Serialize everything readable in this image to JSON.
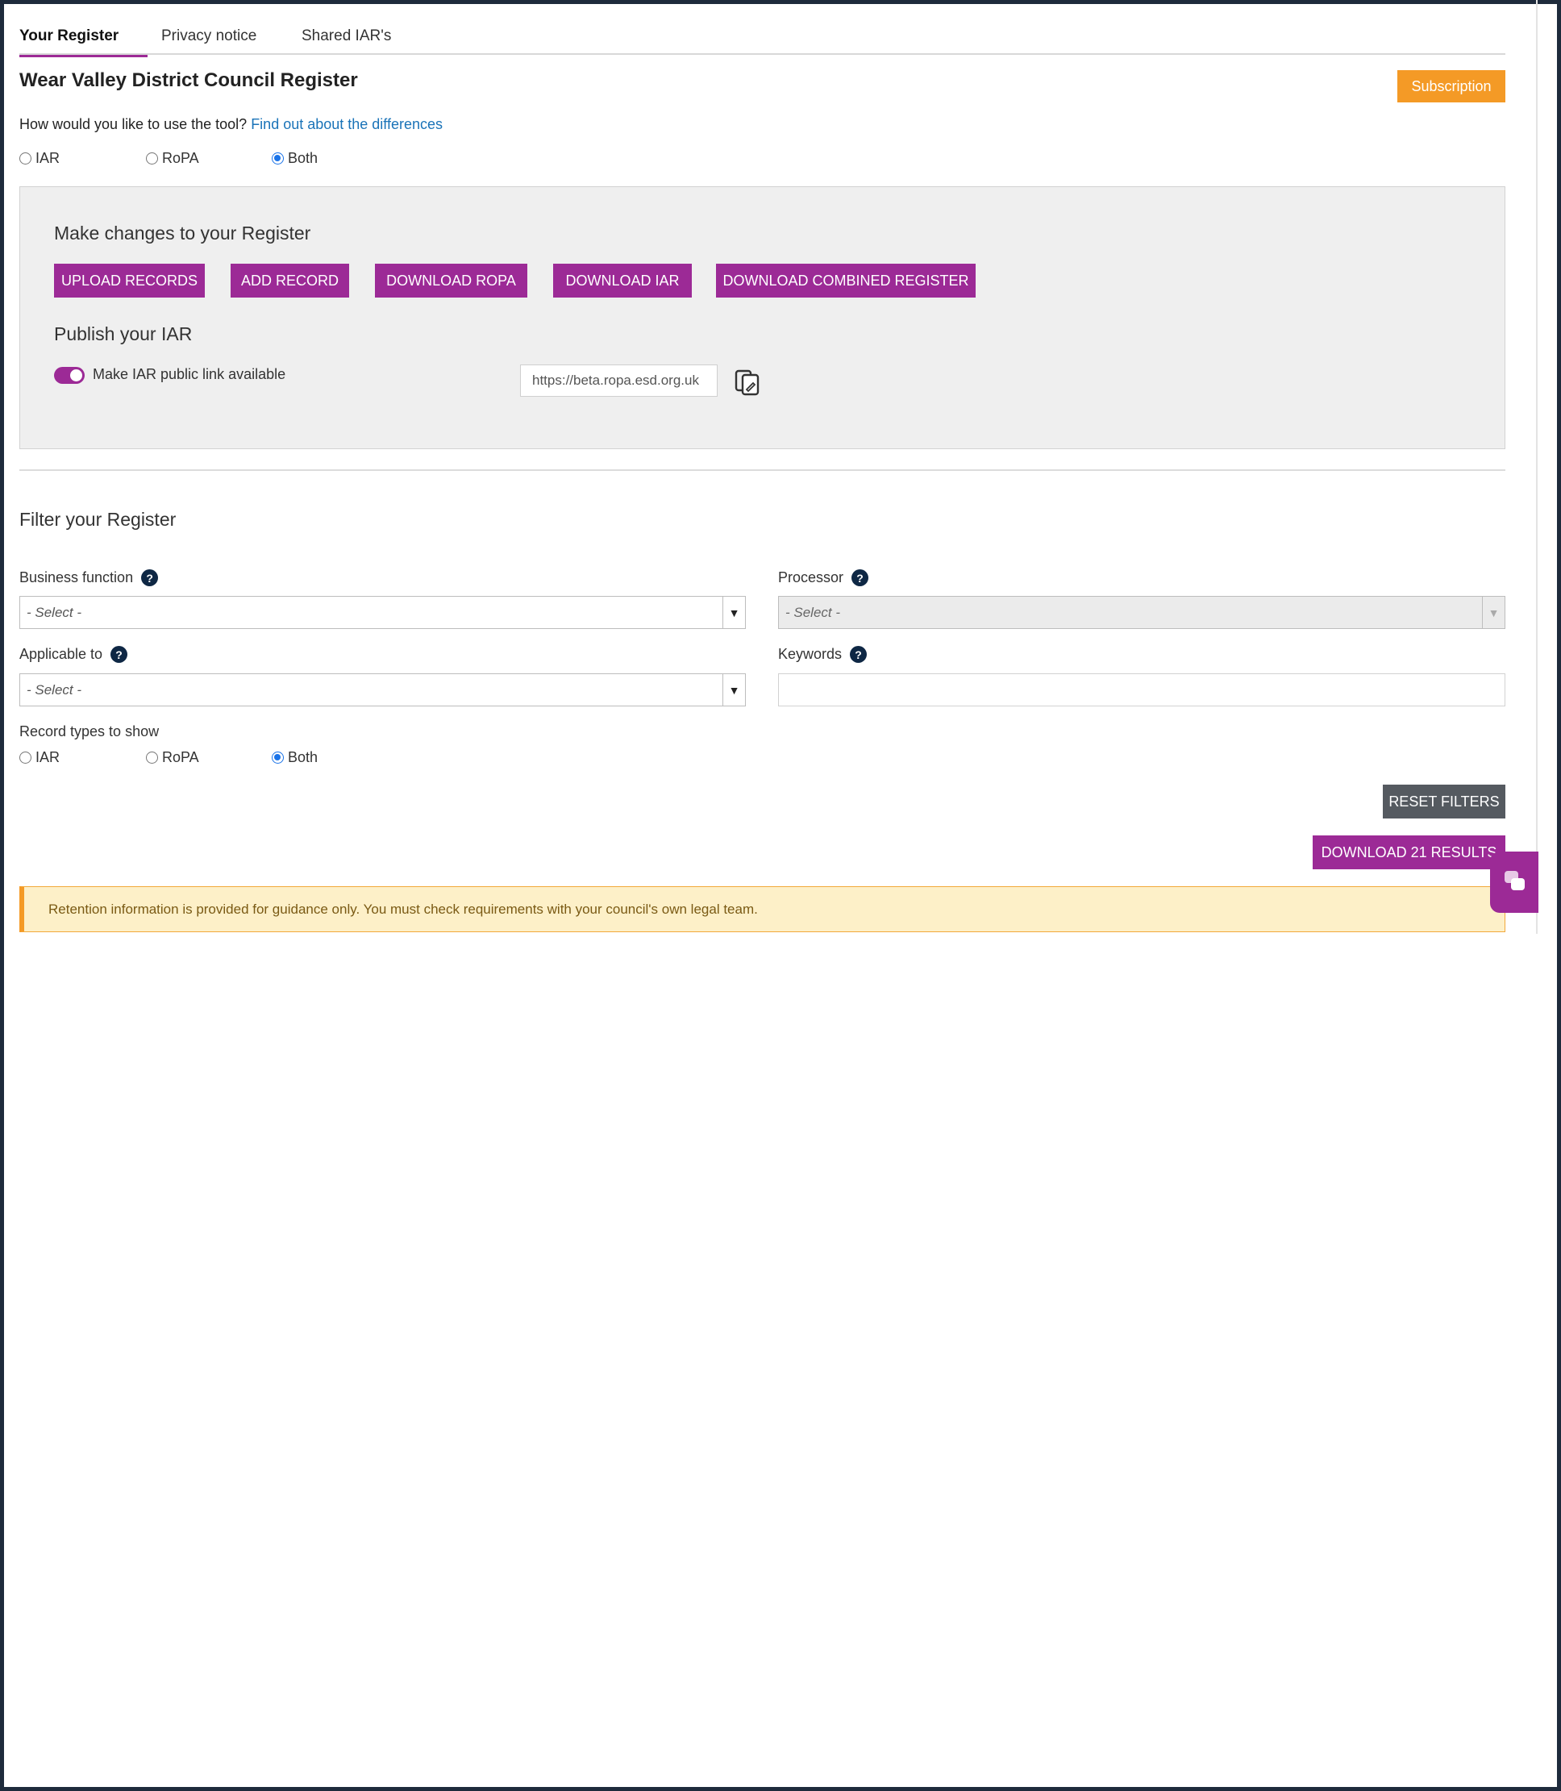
{
  "tabs": [
    {
      "label": "Your Register",
      "active": true
    },
    {
      "label": "Privacy notice",
      "active": false
    },
    {
      "label": "Shared IAR's",
      "active": false
    }
  ],
  "header": {
    "title": "Wear Valley District Council Register",
    "subscription_label": "Subscription"
  },
  "usage": {
    "question": "How would you like to use the tool?",
    "link": "Find out about the differences",
    "options": [
      "IAR",
      "RoPA",
      "Both"
    ],
    "selected": "Both"
  },
  "changes": {
    "heading": "Make changes to your Register",
    "buttons": [
      "UPLOAD RECORDS",
      "ADD RECORD",
      "DOWNLOAD ROPA",
      "DOWNLOAD IAR",
      "DOWNLOAD COMBINED REGISTER"
    ]
  },
  "publish": {
    "heading": "Publish your IAR",
    "toggle_label": "Make IAR public link available",
    "toggle_on": true,
    "link_value": "https://beta.ropa.esd.org.uk"
  },
  "filter": {
    "heading": "Filter your Register",
    "business_function": {
      "label": "Business function",
      "value": "- Select -"
    },
    "processor": {
      "label": "Processor",
      "value": "- Select -"
    },
    "applicable_to": {
      "label": "Applicable to",
      "value": "- Select -"
    },
    "keywords": {
      "label": "Keywords",
      "value": ""
    },
    "record_types": {
      "label": "Record types to show",
      "options": [
        "IAR",
        "RoPA",
        "Both"
      ],
      "selected": "Both"
    },
    "reset_label": "RESET FILTERS",
    "download_results_label": "DOWNLOAD 21 RESULTS"
  },
  "notice": {
    "text": "Retention information is provided for guidance only. You must check requirements with your council's own legal team."
  },
  "colors": {
    "accent": "#9c2a96",
    "subscription": "#f49a26",
    "reset": "#555a60",
    "notice_bg": "#fdf0c8",
    "link": "#1a73b8"
  }
}
